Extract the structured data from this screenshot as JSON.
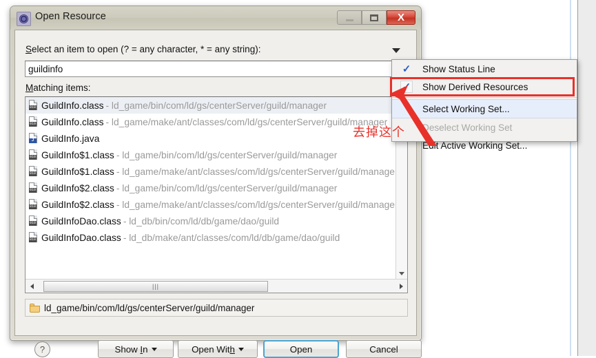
{
  "window": {
    "title": "Open Resource",
    "app_icon": "eclipse-icon",
    "minimize_label": "",
    "maximize_label": "",
    "close_label": "X"
  },
  "form": {
    "select_label_pre": "S",
    "select_label": "elect an item to open (? = any character, * = any string):",
    "filter_arrow": "chevron-down-icon",
    "search_value": "guildinfo",
    "search_placeholder": "",
    "matching_label_pre": "M",
    "matching_label": "atching items:"
  },
  "results": [
    {
      "icon": "class-file-icon",
      "name": "GuildInfo.class",
      "path": "- ld_game/bin/com/ld/gs/centerServer/guild/manager",
      "selected": true
    },
    {
      "icon": "class-file-icon",
      "name": "GuildInfo.class",
      "path": "- ld_game/make/ant/classes/com/ld/gs/centerServer/guild/manager",
      "selected": false
    },
    {
      "icon": "java-file-icon",
      "name": "GuildInfo.java",
      "path": "",
      "selected": false
    },
    {
      "icon": "class-file-icon",
      "name": "GuildInfo$1.class",
      "path": "- ld_game/bin/com/ld/gs/centerServer/guild/manager",
      "selected": false
    },
    {
      "icon": "class-file-icon",
      "name": "GuildInfo$1.class",
      "path": "- ld_game/make/ant/classes/com/ld/gs/centerServer/guild/manager",
      "selected": false
    },
    {
      "icon": "class-file-icon",
      "name": "GuildInfo$2.class",
      "path": "- ld_game/bin/com/ld/gs/centerServer/guild/manager",
      "selected": false
    },
    {
      "icon": "class-file-icon",
      "name": "GuildInfo$2.class",
      "path": "- ld_game/make/ant/classes/com/ld/gs/centerServer/guild/manager",
      "selected": false
    },
    {
      "icon": "class-file-icon",
      "name": "GuildInfoDao.class",
      "path": "- ld_db/bin/com/ld/db/game/dao/guild",
      "selected": false
    },
    {
      "icon": "class-file-icon",
      "name": "GuildInfoDao.class",
      "path": "- ld_db/make/ant/classes/com/ld/db/game/dao/guild",
      "selected": false
    }
  ],
  "scrollbars": {
    "v_up": "scroll-up-icon",
    "v_down": "scroll-down-icon",
    "h_left": "scroll-left-icon",
    "h_right": "scroll-right-icon",
    "h_grip": "|||"
  },
  "status": {
    "folder_icon": "folder-icon",
    "text": "ld_game/bin/com/ld/gs/centerServer/guild/manager"
  },
  "footer": {
    "help_label": "?",
    "show_in_pre": "Show ",
    "show_in_u": "I",
    "show_in_post": "n",
    "open_with_pre": "Open Wit",
    "open_with_u": "h",
    "open_with_post": "",
    "open_label": "Open",
    "cancel_label": "Cancel"
  },
  "menu": {
    "items": [
      {
        "label": "Show Status Line",
        "checked": true,
        "highlighted": false,
        "disabled": false,
        "boxed": false
      },
      {
        "label": "Show Derived Resources",
        "checked": true,
        "highlighted": false,
        "disabled": false,
        "boxed": true
      },
      {
        "label": "Select Working Set...",
        "checked": false,
        "highlighted": true,
        "disabled": false,
        "boxed": false
      },
      {
        "label": "Deselect Working Set",
        "checked": false,
        "highlighted": false,
        "disabled": true,
        "boxed": false
      },
      {
        "label": "Edit Active Working Set...",
        "checked": false,
        "highlighted": false,
        "disabled": false,
        "boxed": false
      }
    ],
    "check_glyph": "✓"
  },
  "annotation": {
    "text": "去掉这个",
    "color": "#e8322b",
    "arrow": "red-arrow-icon"
  }
}
